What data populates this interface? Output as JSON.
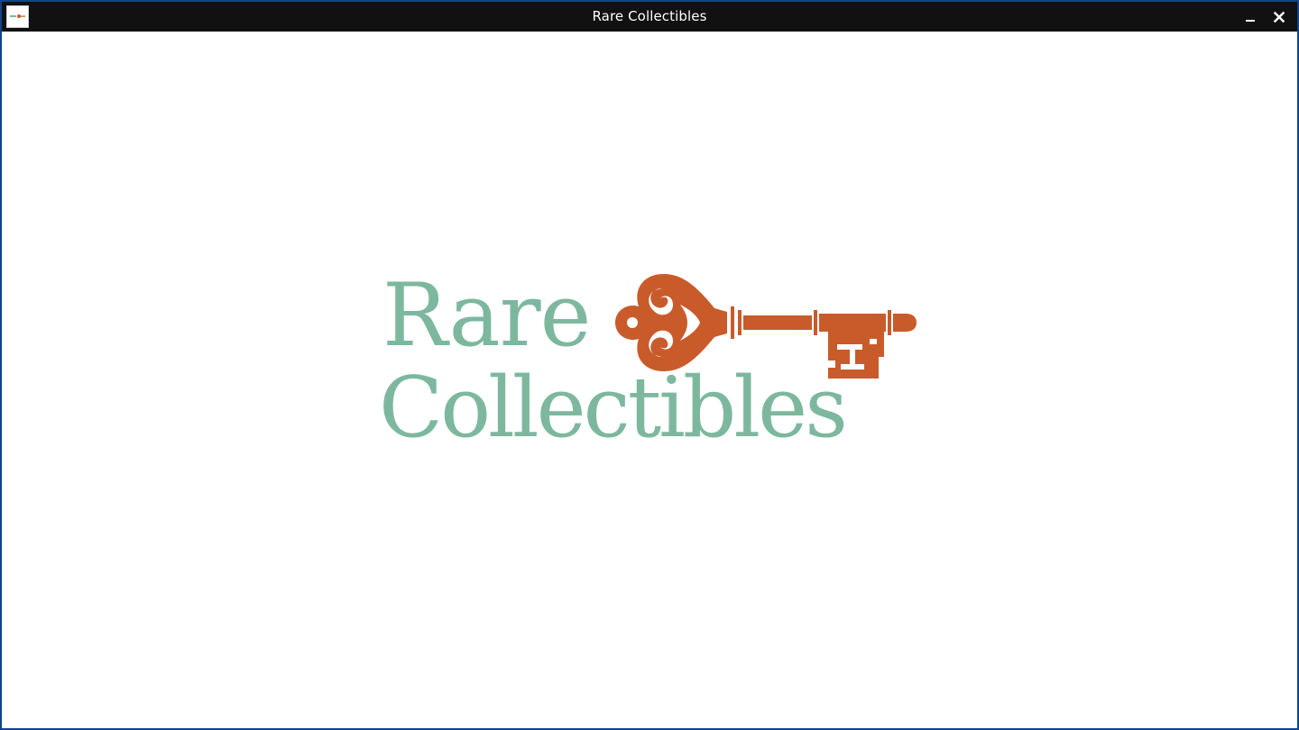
{
  "window": {
    "title": "Rare Collectibles"
  },
  "logo": {
    "line1": "Rare",
    "line2": "Collectibles",
    "text_color": "#7db89e",
    "key_color": "#c95b2b"
  },
  "icons": {
    "app": "app-logo-icon",
    "minimize": "minimize-icon",
    "close": "close-icon",
    "key": "key-icon"
  },
  "colors": {
    "titlebar": "#111111",
    "frame": "#10448c",
    "background": "#ffffff"
  }
}
